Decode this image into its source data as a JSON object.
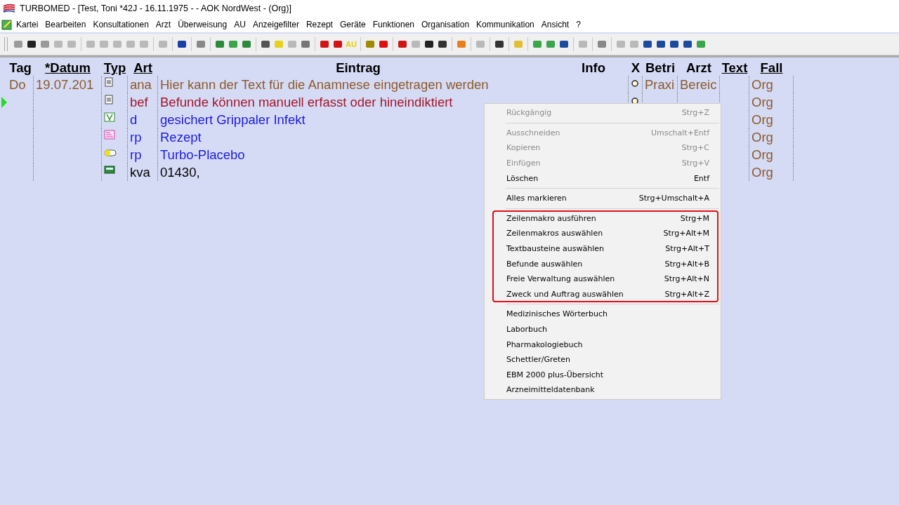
{
  "window": {
    "title": "TURBOMED - [Test, Toni *42J - 16.11.1975 - - AOK NordWest - (Org)]"
  },
  "menu_bar": [
    "Kartei",
    "Bearbeiten",
    "Konsultationen",
    "Arzt",
    "Überweisung",
    "AU",
    "Anzeigefilter",
    "Rezept",
    "Geräte",
    "Funktionen",
    "Organisation",
    "Kommunikation",
    "Ansicht",
    "?"
  ],
  "toolbar": {
    "label": "AU"
  },
  "table": {
    "columns": [
      {
        "label": "Tag",
        "underlined": false
      },
      {
        "label": "*Datum",
        "underlined": true
      },
      {
        "label": "Typ",
        "underlined": true
      },
      {
        "label": "Art",
        "underlined": true
      },
      {
        "label": "Eintrag",
        "underlined": false
      },
      {
        "label": "Info",
        "underlined": false
      },
      {
        "label": "X",
        "underlined": false
      },
      {
        "label": "Betri",
        "underlined": false
      },
      {
        "label": "Arzt",
        "underlined": false
      },
      {
        "label": "Text",
        "underlined": true
      },
      {
        "label": "Fall",
        "underlined": true
      }
    ],
    "rows": [
      {
        "tag": "Do",
        "datum": "19.07.201",
        "kind": "document",
        "art": "ana",
        "eintrag": "Hier kann der Text für die Anamnese eingetragen werden",
        "color": "#8b5a2b",
        "current": false,
        "x_mark": true,
        "betri": "Praxi",
        "arzt": "Bereic",
        "fall": "Org"
      },
      {
        "kind": "document",
        "art": "bef",
        "eintrag": "Befunde können manuell erfasst oder hineindiktiert",
        "color": "#a3162a",
        "current": true,
        "x_mark": true,
        "fall": "Org"
      },
      {
        "kind": "diagnosis",
        "art": "d",
        "eintrag": "gesichert Grippaler Infekt",
        "color": "#1c1ce0",
        "current": false,
        "fall": "Org"
      },
      {
        "kind": "prescription",
        "art": "rp",
        "eintrag": "Rezept",
        "color": "#1c1ce0",
        "current": false,
        "fall": "Org"
      },
      {
        "kind": "pill",
        "art": "rp",
        "eintrag": "Turbo-Placebo",
        "color": "#1c1ce0",
        "current": false,
        "fall": "Org"
      },
      {
        "kind": "calculator",
        "art": "kva",
        "eintrag": "01430,",
        "color": "#000000",
        "current": false,
        "fall": "Org"
      }
    ]
  },
  "context_menu": {
    "sections": [
      {
        "highlighted": false,
        "items": [
          {
            "label": "Rückgängig",
            "shortcut": "Strg+Z",
            "disabled": true
          }
        ]
      },
      {
        "highlighted": false,
        "items": [
          {
            "label": "Ausschneiden",
            "shortcut": "Umschalt+Entf",
            "disabled": true
          },
          {
            "label": "Kopieren",
            "shortcut": "Strg+C",
            "disabled": true
          },
          {
            "label": "Einfügen",
            "shortcut": "Strg+V",
            "disabled": true
          },
          {
            "label": "Löschen",
            "shortcut": "Entf",
            "disabled": false
          }
        ]
      },
      {
        "highlighted": false,
        "items": [
          {
            "label": "Alles markieren",
            "shortcut": "Strg+Umschalt+A",
            "disabled": false
          }
        ]
      },
      {
        "highlighted": true,
        "items": [
          {
            "label": "Zeilenmakro ausführen",
            "shortcut": "Strg+M",
            "disabled": false
          },
          {
            "label": "Zeilenmakros auswählen",
            "shortcut": "Strg+Alt+M",
            "disabled": false
          },
          {
            "label": "Textbausteine auswählen",
            "shortcut": "Strg+Alt+T",
            "disabled": false
          },
          {
            "label": "Befunde auswählen",
            "shortcut": "Strg+Alt+B",
            "disabled": false
          },
          {
            "label": "Freie Verwaltung auswählen",
            "shortcut": "Strg+Alt+N",
            "disabled": false
          },
          {
            "label": "Zweck und Auftrag auswählen",
            "shortcut": "Strg+Alt+Z",
            "disabled": false
          }
        ]
      },
      {
        "highlighted": false,
        "items": [
          {
            "label": "Medizinisches Wörterbuch",
            "disabled": false
          },
          {
            "label": "Laborbuch",
            "disabled": false
          },
          {
            "label": "Pharmakologiebuch",
            "disabled": false
          },
          {
            "label": "Schettler/Greten",
            "disabled": false
          },
          {
            "label": "EBM 2000 plus-Übersicht",
            "disabled": false
          },
          {
            "label": "Arzneimitteldatenbank",
            "disabled": false
          }
        ]
      }
    ]
  }
}
